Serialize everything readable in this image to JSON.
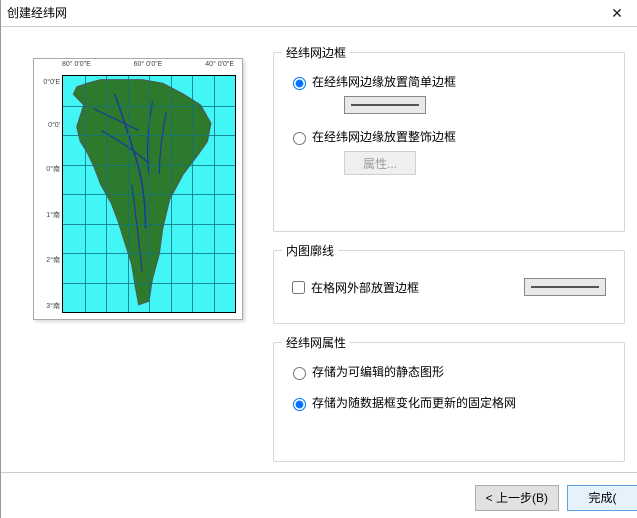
{
  "window": {
    "title": "创建经纬网",
    "close_icon_label": "✕"
  },
  "preview": {
    "axis_top": [
      "80° 0'0\"E",
      "60° 0'0\"E",
      "40° 0'0\"E"
    ],
    "axis_left": [
      "0°0'E",
      "0°0'",
      "0°南",
      "1°南",
      "2°南",
      "3°南"
    ]
  },
  "group_border": {
    "legend": "经纬网边框",
    "opt_simple": "在经纬网边缘放置简单边框",
    "opt_decor": "在经纬网边缘放置整饰边框",
    "props_btn": "属性..."
  },
  "group_neatline": {
    "legend": "内图廓线",
    "chk_outside": "在格网外部放置边框"
  },
  "group_props": {
    "legend": "经纬网属性",
    "opt_static": "存储为可编辑的静态图形",
    "opt_dynamic": "存储为随数据框变化而更新的固定格网"
  },
  "buttons": {
    "back": "< 上一步(B)",
    "finish": "完成("
  }
}
